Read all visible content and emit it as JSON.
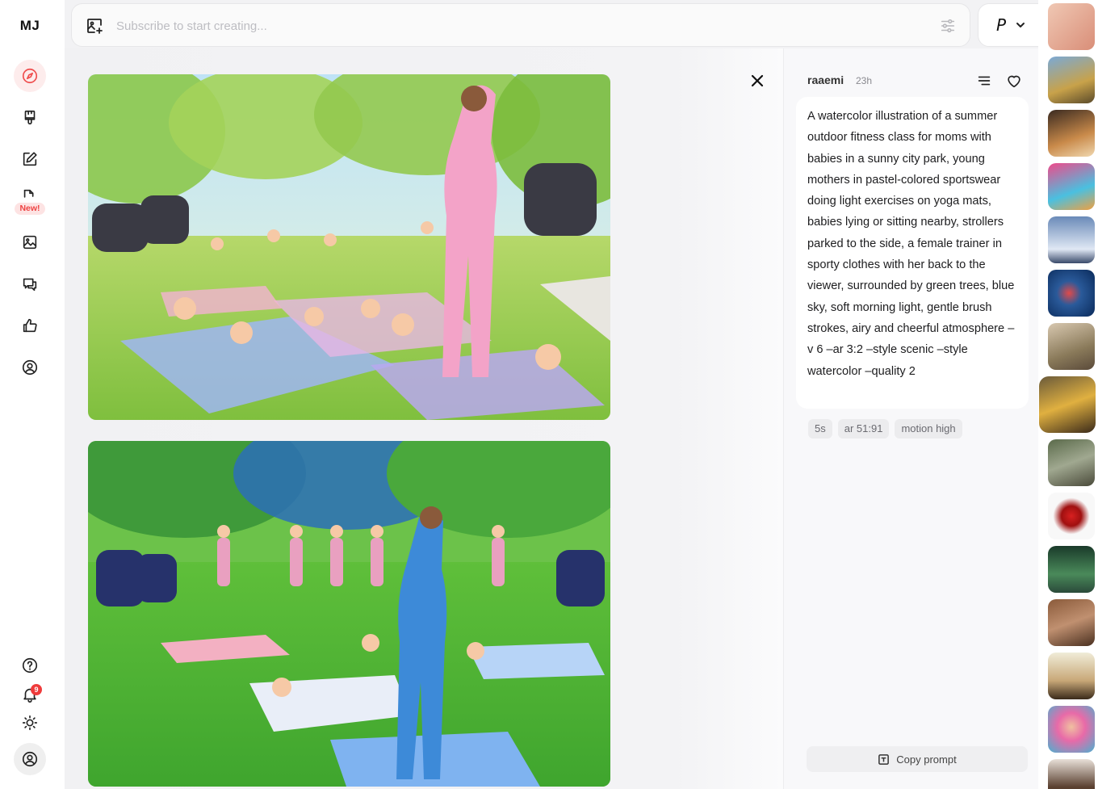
{
  "sidebar": {
    "logo": "MJ",
    "new_badge": "New!",
    "notification_count": "9",
    "items": [
      {
        "name": "explore-icon",
        "active": true
      },
      {
        "name": "create-brush-icon"
      },
      {
        "name": "edit-icon"
      },
      {
        "name": "video-icon"
      },
      {
        "name": "organize-images-icon"
      },
      {
        "name": "chat-icon"
      },
      {
        "name": "likes-thumbs-up-icon"
      },
      {
        "name": "profile-icon"
      }
    ],
    "bottom": [
      {
        "name": "help-icon"
      },
      {
        "name": "notifications-bell-icon"
      },
      {
        "name": "theme-sun-icon"
      },
      {
        "name": "account-avatar-icon"
      }
    ]
  },
  "search": {
    "placeholder": "Subscribe to start creating...",
    "mode_label": "P"
  },
  "post": {
    "username": "raaemi",
    "time": "23h",
    "prompt": "A watercolor illustration of a summer outdoor fitness class for moms with babies in a sunny city park, young mothers in pastel-colored sportswear doing light exercises on yoga mats, babies lying or sitting nearby, strollers parked to the side, a female trainer in sporty clothes with her back to the viewer, surrounded by green trees, blue sky, soft morning light, gentle brush strokes, airy and cheerful atmosphere –v 6 –ar 3:2 –style scenic –style watercolor –quality 2",
    "tags": [
      "5s",
      "ar 51:91",
      "motion high"
    ],
    "copy_label": "Copy prompt"
  },
  "colors": {
    "accent": "#ef4d4d",
    "badge_bg": "#fde3e3"
  }
}
